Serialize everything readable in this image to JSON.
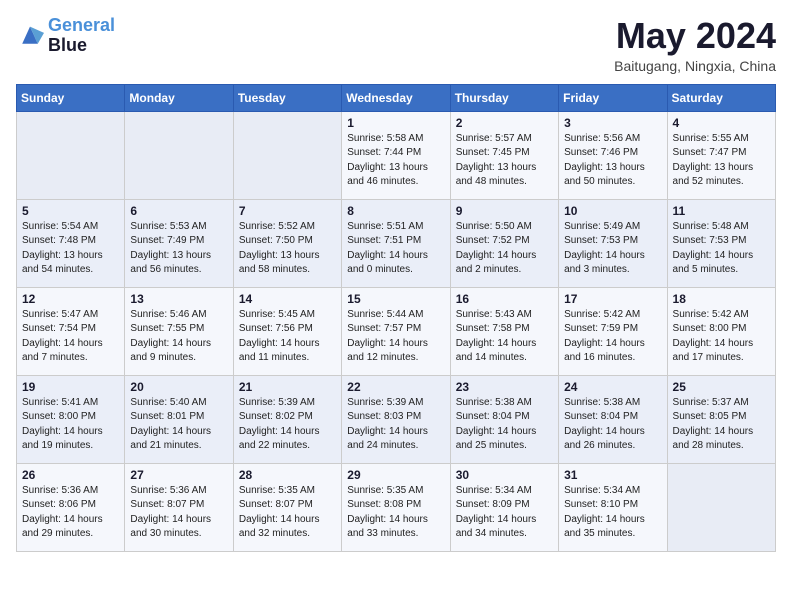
{
  "header": {
    "logo_line1": "General",
    "logo_line2": "Blue",
    "month_title": "May 2024",
    "location": "Baitugang, Ningxia, China"
  },
  "weekdays": [
    "Sunday",
    "Monday",
    "Tuesday",
    "Wednesday",
    "Thursday",
    "Friday",
    "Saturday"
  ],
  "weeks": [
    [
      {
        "day": "",
        "sunrise": "",
        "sunset": "",
        "daylight": ""
      },
      {
        "day": "",
        "sunrise": "",
        "sunset": "",
        "daylight": ""
      },
      {
        "day": "",
        "sunrise": "",
        "sunset": "",
        "daylight": ""
      },
      {
        "day": "1",
        "sunrise": "Sunrise: 5:58 AM",
        "sunset": "Sunset: 7:44 PM",
        "daylight": "Daylight: 13 hours and 46 minutes."
      },
      {
        "day": "2",
        "sunrise": "Sunrise: 5:57 AM",
        "sunset": "Sunset: 7:45 PM",
        "daylight": "Daylight: 13 hours and 48 minutes."
      },
      {
        "day": "3",
        "sunrise": "Sunrise: 5:56 AM",
        "sunset": "Sunset: 7:46 PM",
        "daylight": "Daylight: 13 hours and 50 minutes."
      },
      {
        "day": "4",
        "sunrise": "Sunrise: 5:55 AM",
        "sunset": "Sunset: 7:47 PM",
        "daylight": "Daylight: 13 hours and 52 minutes."
      }
    ],
    [
      {
        "day": "5",
        "sunrise": "Sunrise: 5:54 AM",
        "sunset": "Sunset: 7:48 PM",
        "daylight": "Daylight: 13 hours and 54 minutes."
      },
      {
        "day": "6",
        "sunrise": "Sunrise: 5:53 AM",
        "sunset": "Sunset: 7:49 PM",
        "daylight": "Daylight: 13 hours and 56 minutes."
      },
      {
        "day": "7",
        "sunrise": "Sunrise: 5:52 AM",
        "sunset": "Sunset: 7:50 PM",
        "daylight": "Daylight: 13 hours and 58 minutes."
      },
      {
        "day": "8",
        "sunrise": "Sunrise: 5:51 AM",
        "sunset": "Sunset: 7:51 PM",
        "daylight": "Daylight: 14 hours and 0 minutes."
      },
      {
        "day": "9",
        "sunrise": "Sunrise: 5:50 AM",
        "sunset": "Sunset: 7:52 PM",
        "daylight": "Daylight: 14 hours and 2 minutes."
      },
      {
        "day": "10",
        "sunrise": "Sunrise: 5:49 AM",
        "sunset": "Sunset: 7:53 PM",
        "daylight": "Daylight: 14 hours and 3 minutes."
      },
      {
        "day": "11",
        "sunrise": "Sunrise: 5:48 AM",
        "sunset": "Sunset: 7:53 PM",
        "daylight": "Daylight: 14 hours and 5 minutes."
      }
    ],
    [
      {
        "day": "12",
        "sunrise": "Sunrise: 5:47 AM",
        "sunset": "Sunset: 7:54 PM",
        "daylight": "Daylight: 14 hours and 7 minutes."
      },
      {
        "day": "13",
        "sunrise": "Sunrise: 5:46 AM",
        "sunset": "Sunset: 7:55 PM",
        "daylight": "Daylight: 14 hours and 9 minutes."
      },
      {
        "day": "14",
        "sunrise": "Sunrise: 5:45 AM",
        "sunset": "Sunset: 7:56 PM",
        "daylight": "Daylight: 14 hours and 11 minutes."
      },
      {
        "day": "15",
        "sunrise": "Sunrise: 5:44 AM",
        "sunset": "Sunset: 7:57 PM",
        "daylight": "Daylight: 14 hours and 12 minutes."
      },
      {
        "day": "16",
        "sunrise": "Sunrise: 5:43 AM",
        "sunset": "Sunset: 7:58 PM",
        "daylight": "Daylight: 14 hours and 14 minutes."
      },
      {
        "day": "17",
        "sunrise": "Sunrise: 5:42 AM",
        "sunset": "Sunset: 7:59 PM",
        "daylight": "Daylight: 14 hours and 16 minutes."
      },
      {
        "day": "18",
        "sunrise": "Sunrise: 5:42 AM",
        "sunset": "Sunset: 8:00 PM",
        "daylight": "Daylight: 14 hours and 17 minutes."
      }
    ],
    [
      {
        "day": "19",
        "sunrise": "Sunrise: 5:41 AM",
        "sunset": "Sunset: 8:00 PM",
        "daylight": "Daylight: 14 hours and 19 minutes."
      },
      {
        "day": "20",
        "sunrise": "Sunrise: 5:40 AM",
        "sunset": "Sunset: 8:01 PM",
        "daylight": "Daylight: 14 hours and 21 minutes."
      },
      {
        "day": "21",
        "sunrise": "Sunrise: 5:39 AM",
        "sunset": "Sunset: 8:02 PM",
        "daylight": "Daylight: 14 hours and 22 minutes."
      },
      {
        "day": "22",
        "sunrise": "Sunrise: 5:39 AM",
        "sunset": "Sunset: 8:03 PM",
        "daylight": "Daylight: 14 hours and 24 minutes."
      },
      {
        "day": "23",
        "sunrise": "Sunrise: 5:38 AM",
        "sunset": "Sunset: 8:04 PM",
        "daylight": "Daylight: 14 hours and 25 minutes."
      },
      {
        "day": "24",
        "sunrise": "Sunrise: 5:38 AM",
        "sunset": "Sunset: 8:04 PM",
        "daylight": "Daylight: 14 hours and 26 minutes."
      },
      {
        "day": "25",
        "sunrise": "Sunrise: 5:37 AM",
        "sunset": "Sunset: 8:05 PM",
        "daylight": "Daylight: 14 hours and 28 minutes."
      }
    ],
    [
      {
        "day": "26",
        "sunrise": "Sunrise: 5:36 AM",
        "sunset": "Sunset: 8:06 PM",
        "daylight": "Daylight: 14 hours and 29 minutes."
      },
      {
        "day": "27",
        "sunrise": "Sunrise: 5:36 AM",
        "sunset": "Sunset: 8:07 PM",
        "daylight": "Daylight: 14 hours and 30 minutes."
      },
      {
        "day": "28",
        "sunrise": "Sunrise: 5:35 AM",
        "sunset": "Sunset: 8:07 PM",
        "daylight": "Daylight: 14 hours and 32 minutes."
      },
      {
        "day": "29",
        "sunrise": "Sunrise: 5:35 AM",
        "sunset": "Sunset: 8:08 PM",
        "daylight": "Daylight: 14 hours and 33 minutes."
      },
      {
        "day": "30",
        "sunrise": "Sunrise: 5:34 AM",
        "sunset": "Sunset: 8:09 PM",
        "daylight": "Daylight: 14 hours and 34 minutes."
      },
      {
        "day": "31",
        "sunrise": "Sunrise: 5:34 AM",
        "sunset": "Sunset: 8:10 PM",
        "daylight": "Daylight: 14 hours and 35 minutes."
      },
      {
        "day": "",
        "sunrise": "",
        "sunset": "",
        "daylight": ""
      }
    ]
  ]
}
